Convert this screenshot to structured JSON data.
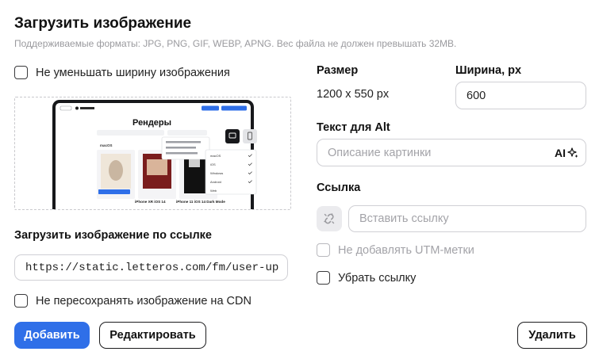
{
  "header": {
    "title": "Загрузить изображение",
    "subtitle": "Поддерживаемые форматы: JPG, PNG, GIF, WEBP, APNG. Вес файла не должен превышать 32MB."
  },
  "left": {
    "keep_width_label": "Не уменьшать ширину изображения",
    "upload_by_url_label": "Загрузить изображение по ссылке",
    "url_value": "https://static.letteros.com/fm/user-up",
    "no_cdn_label": "Не пересохранять изображение на CDN",
    "preview": {
      "page_title": "Рендеры",
      "menu_items": [
        "macOS",
        "iOS",
        "Windows",
        "Android",
        "Web"
      ],
      "card_captions": [
        "iPhone XR iOS 14",
        "iPhone 11 iOS 14 Dark Mode"
      ],
      "button_labels": [
        "Посмотреть",
        "Скачать",
        "Создать проект"
      ]
    }
  },
  "right": {
    "size_label": "Размер",
    "size_value": "1200 x 550 px",
    "width_label": "Ширина, px",
    "width_value": "600",
    "alt_label": "Текст для Alt",
    "alt_placeholder": "Описание картинки",
    "ai_label": "AI",
    "link_label": "Ссылка",
    "link_placeholder": "Вставить ссылку",
    "no_utm_label": "Не добавлять UTM-метки",
    "remove_link_label": "Убрать ссылку"
  },
  "footer": {
    "add_label": "Добавить",
    "edit_label": "Редактировать",
    "delete_label": "Удалить"
  },
  "colors": {
    "primary": "#2f6fe8",
    "muted_text": "#a3a3a8",
    "border": "#d0d0d5"
  }
}
